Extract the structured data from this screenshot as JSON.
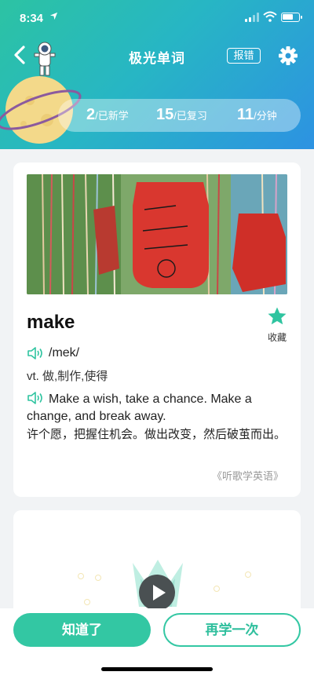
{
  "status_bar": {
    "time": "8:34"
  },
  "header": {
    "title": "极光单词",
    "report_label": "报错"
  },
  "stats": [
    {
      "num": "2",
      "label": "/已新学"
    },
    {
      "num": "15",
      "label": "/已复习"
    },
    {
      "num": "11",
      "label": "/分钟"
    }
  ],
  "word_card": {
    "word": "make",
    "favorite_label": "收藏",
    "phonetic": "/mek/",
    "meaning": "vt. 做,制作,使得",
    "example_en": "Make a wish, take a chance. Make a change, and break away.",
    "example_cn": "许个愿，把握住机会。做出改变，然后破茧而出。",
    "source": "《听歌学英语》"
  },
  "actions": {
    "know_label": "知道了",
    "again_label": "再学一次"
  },
  "colors": {
    "accent": "#33c7a3",
    "header_start": "#2cc3a3",
    "header_end": "#2d92e2",
    "star": "#2fc4a0"
  }
}
